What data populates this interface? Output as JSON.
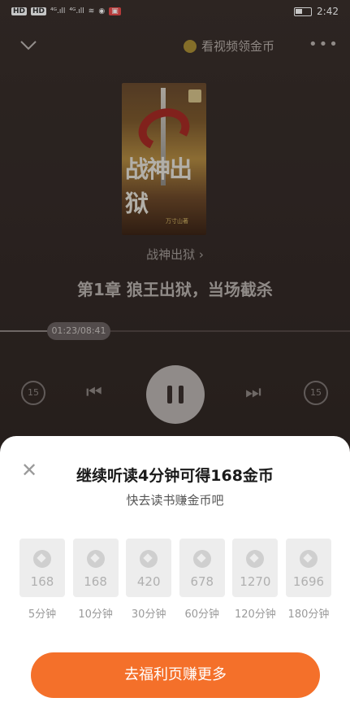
{
  "status_bar": {
    "left_chips": [
      "HD",
      "HD",
      "⁴ᴳ.ıll",
      "⁴ᴳ.ıll"
    ],
    "time": "2:42"
  },
  "top_bar": {
    "coin_link_label": "看视频领金币"
  },
  "book": {
    "cover_title": "战神出狱",
    "cover_author": "万寸山著",
    "name": "战神出狱",
    "chapter": "第1章 狼王出狱，当场截杀"
  },
  "player": {
    "time_display": "01:23/08:41",
    "progress_fraction": 0.159,
    "rewind_label": "15",
    "forward_label": "15"
  },
  "sheet": {
    "title": "继续听读4分钟可得168金币",
    "subtitle": "快去读书赚金币吧",
    "rewards": [
      {
        "coins": "168",
        "time": "5分钟"
      },
      {
        "coins": "168",
        "time": "10分钟"
      },
      {
        "coins": "420",
        "time": "30分钟"
      },
      {
        "coins": "678",
        "time": "60分钟"
      },
      {
        "coins": "1270",
        "time": "120分钟"
      },
      {
        "coins": "1696",
        "time": "180分钟"
      }
    ],
    "cta_label": "去福利页赚更多"
  }
}
